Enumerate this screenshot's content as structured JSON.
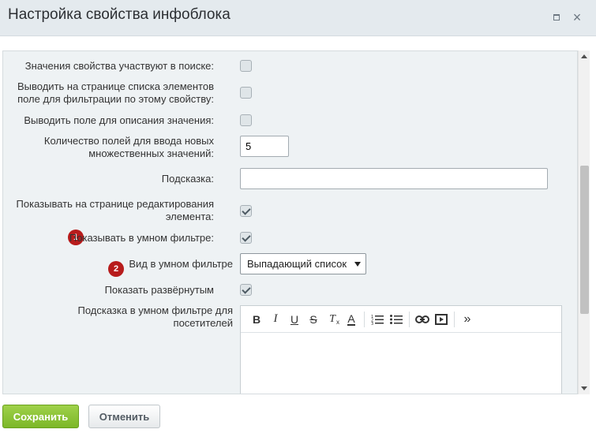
{
  "dialog": {
    "title": "Настройка свойства инфоблока",
    "maximize_icon": "maximize-icon",
    "close_icon": "close-icon",
    "close_glyph": "×"
  },
  "form": {
    "search_label": "Значения свойства участвуют в поиске:",
    "filter_label_line1": "Выводить на странице списка элементов",
    "filter_label_line2": "поле для фильтрации по этому свойству:",
    "description_label": "Выводить поле для описания значения:",
    "multiple_label_line1": "Количество полей для ввода новых",
    "multiple_label_line2": "множественных значений:",
    "multiple_value": "5",
    "hint_label": "Подсказка:",
    "hint_value": "",
    "show_edit_label_line1": "Показывать на странице редактирования",
    "show_edit_label_line2": "элемента:",
    "smart_filter_label": "Показывать в умном фильтре:",
    "smart_filter_marker": "1",
    "smart_view_label": "Вид в умном фильтре",
    "smart_view_marker": "2",
    "smart_view_value": "Выпадающий список",
    "expanded_label": "Показать развёрнутым",
    "smart_hint_label_line1": "Подсказка в умном фильтре для",
    "smart_hint_label_line2": "посетителей"
  },
  "checkboxes": {
    "search": false,
    "filter": false,
    "description": false,
    "show_edit": true,
    "smart_filter": true,
    "expanded": true
  },
  "editor_toolbar": {
    "bold": "B",
    "italic": "I",
    "underline": "U",
    "strike": "S",
    "clear_format": "T",
    "font_color": "A",
    "more": "»"
  },
  "footer": {
    "save_label": "Сохранить",
    "cancel_label": "Отменить"
  },
  "colors": {
    "marker": "#b71c1c",
    "save_button": "#8bc34a"
  }
}
